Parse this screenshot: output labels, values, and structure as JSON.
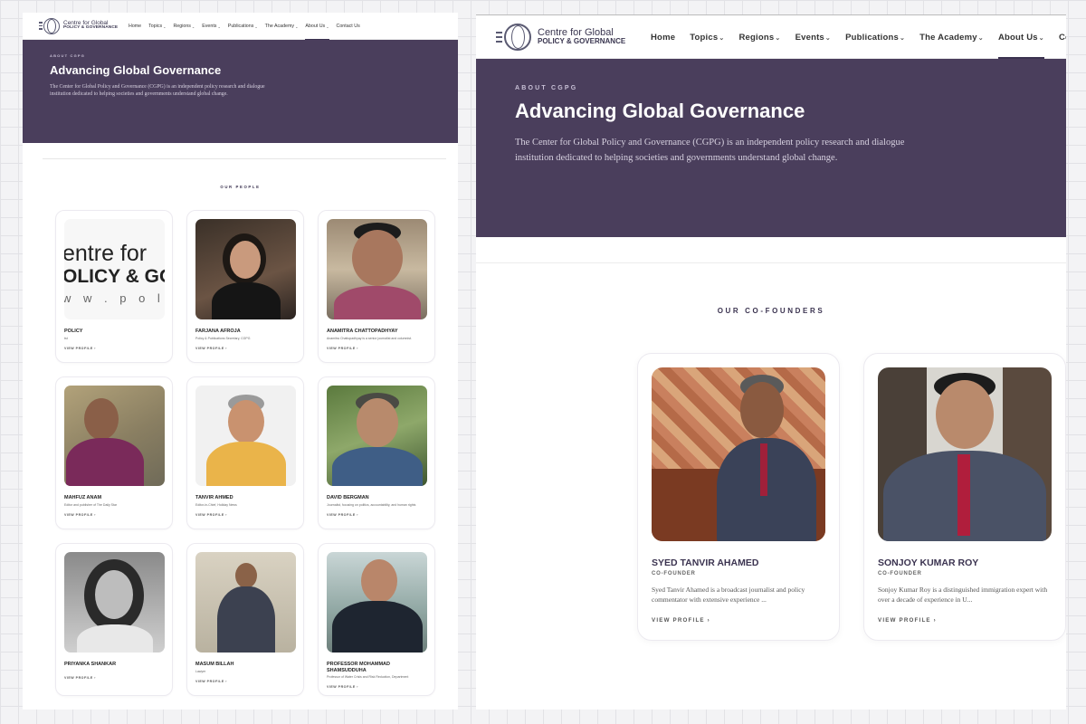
{
  "logo": {
    "line1": "Centre for Global",
    "line2": "POLICY & GOVERNANCE"
  },
  "nav": {
    "home": "Home",
    "topics": "Topics",
    "regions": "Regions",
    "events": "Events",
    "publications": "Publications",
    "academy": "The Academy",
    "about": "About Us",
    "contact": "Contact Us",
    "contact_truncated": "Con"
  },
  "hero": {
    "eyebrow": "ABOUT CGPG",
    "title": "Advancing Global Governance",
    "description": "The Center for Global Policy and Governance (CGPG) is an independent policy research and dialogue institution dedicated to helping societies and governments understand global change."
  },
  "people_section": {
    "title": "OUR PEOPLE",
    "view_profile": "VIEW PROFILE",
    "arrow": "›",
    "logo_card_text": {
      "line1": "entre for",
      "line2": "OLICY & GO",
      "line3": "w w . p o l i c"
    },
    "people": [
      {
        "name": "POLICY",
        "role": "tst"
      },
      {
        "name": "FARJANA AFROJA",
        "role": "Policy & Publications Secretary, CGPG"
      },
      {
        "name": "ANAMITRA CHATTOPADHYAY",
        "role": "Anamitra Chattopadhyay is a senior journalist and columnist."
      },
      {
        "name": "MAHFUZ ANAM",
        "role": "Editor and publisher of The Daily Star"
      },
      {
        "name": "TANVIR AHMED",
        "role": "Editor-in-Chief, Holiday News"
      },
      {
        "name": "DAVID BERGMAN",
        "role": "Journalist, focusing on politics, accountability, and human rights"
      },
      {
        "name": "PRIYANKA SHANKAR",
        "role": ""
      },
      {
        "name": "MASUM BILLAH",
        "role": "Lawyer"
      },
      {
        "name": "PROFESSOR MOHAMMAD SHAMSUDDUHA",
        "role": "Professor of Water Crisis and Risk Reduction, Department"
      }
    ]
  },
  "cofounders_section": {
    "title": "OUR CO-FOUNDERS",
    "view_profile": "VIEW PROFILE",
    "arrow": "›",
    "people": [
      {
        "name": "SYED TANVIR AHAMED",
        "role": "CO-FOUNDER",
        "bio": "Syed Tanvir Ahamed is a broadcast journalist and policy commentator with extensive experience ..."
      },
      {
        "name": "SONJOY KUMAR ROY",
        "role": "CO-FOUNDER",
        "bio": "Sonjoy Kumar Roy is a distinguished immigration expert with over a decade of experience in U..."
      }
    ]
  },
  "colors": {
    "hero_bg": "#4a3e5c",
    "accent": "#3b3350",
    "card_border": "#eceaf0"
  }
}
